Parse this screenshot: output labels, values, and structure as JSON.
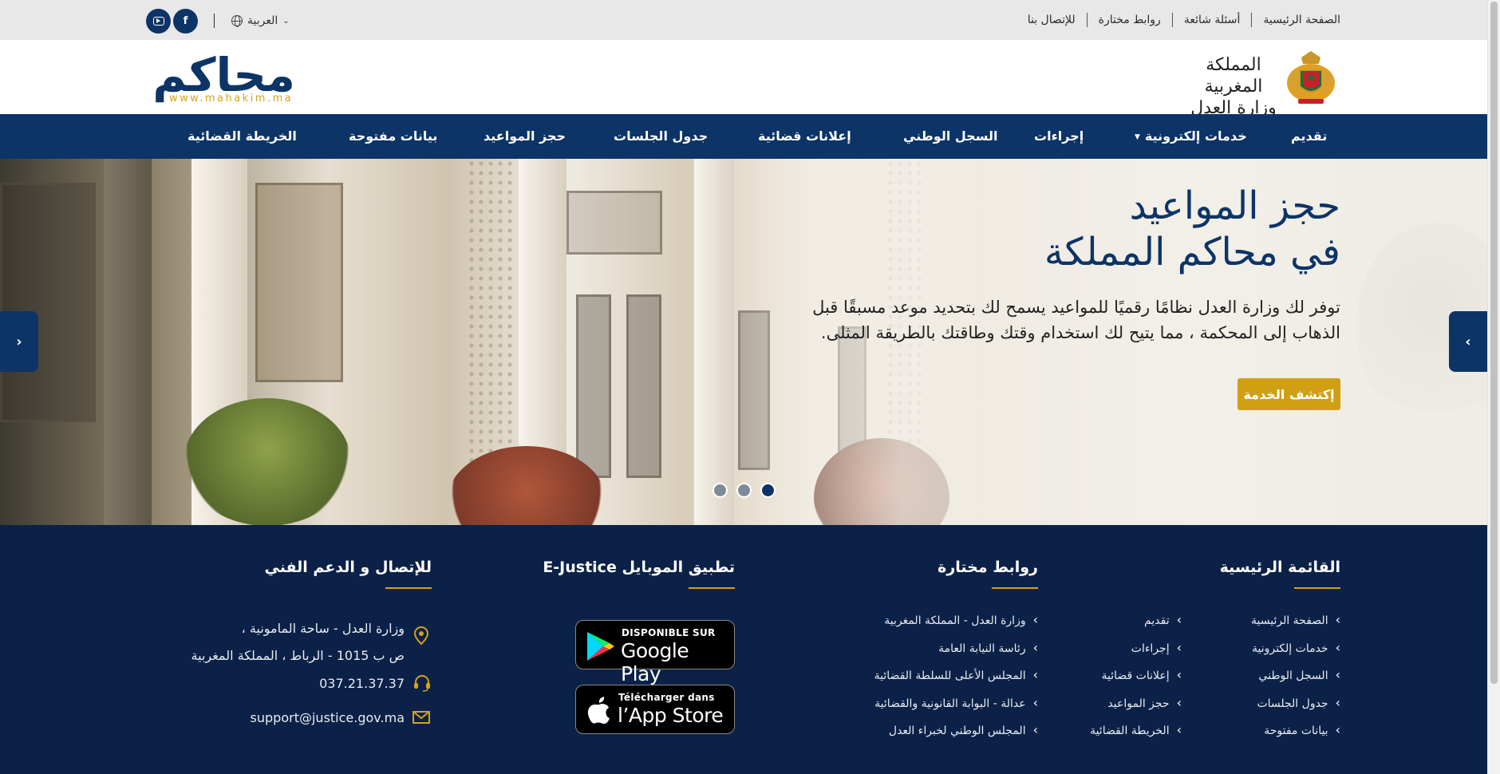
{
  "topbar": {
    "links": [
      "الصفحة الرئيسية",
      "أسئلة شائعة",
      "روابط مختارة",
      "للإتصال بنا"
    ],
    "language": "العربية",
    "social": [
      {
        "name": "facebook-icon",
        "glyph": "f"
      },
      {
        "name": "youtube-icon",
        "glyph": "▶"
      }
    ]
  },
  "header": {
    "logo_text": "محاكم",
    "logo_url": "www.mahakim.ma",
    "ministry_line1": "المملكة المغربية",
    "ministry_line2": "وزارة العدل"
  },
  "nav": {
    "items": [
      "تقديم",
      "خدمات إلكترونية",
      "إجراءات",
      "السجل الوطني",
      "إعلانات قضائية",
      "جدول الجلسات",
      "حجز المواعيد",
      "بيانات مفتوحة",
      "الخريطة القضائية"
    ]
  },
  "hero": {
    "title_line1": "حجز المواعيد",
    "title_line2": "في محاكم المملكة",
    "description": "توفر لك وزارة العدل نظامًا رقميًا للمواعيد يسمح لك بتحديد موعد مسبقًا قبل الذهاب إلى المحكمة ، مما يتيح لك استخدام وقتك وطاقتك بالطريقة المثلى.",
    "button": "إكتشف الخدمة",
    "prev_glyph": "‹",
    "next_glyph": "›",
    "slides_count": 3,
    "active_slide": 1
  },
  "footer": {
    "col_main": {
      "title": "القائمة الرئيسية",
      "list_a": [
        "الصفحة الرئيسية",
        "خدمات إلكترونية",
        "السجل الوطني",
        "جدول الجلسات",
        "بيانات مفتوحة"
      ],
      "list_b": [
        "تقديم",
        "إجراءات",
        "إعلانات قضائية",
        "حجز المواعيد",
        "الخريطة القضائية"
      ]
    },
    "col_links": {
      "title": "روابط مختارة",
      "list": [
        "وزارة العدل - المملكة المغربية",
        "رئاسة النيابة العامة",
        "المجلس الأعلى للسلطة القضائية",
        "عدالة - البوابة القانونية والقضائية",
        "المجلس الوطني لخبراء العدل"
      ]
    },
    "col_app": {
      "title": "تطبيق الموبايل E-Justice",
      "google_small": "DISPONIBLE SUR",
      "google_big": "Google Play",
      "apple_small": "Télécharger dans",
      "apple_big": "l’App Store"
    },
    "col_contact": {
      "title": "للإتصال و الدعم الفني",
      "address_line1": "وزارة العدل - ساحة المامونية ،",
      "address_line2": "ص ب 1015 - الرباط ، المملكة المغربية",
      "phone": "037.21.37.37",
      "email": "support@justice.gov.ma"
    }
  },
  "colors": {
    "primary": "#0d3466",
    "accent": "#d09f13",
    "footer_bg": "#0b2147",
    "topbar_bg": "#e8e8e8"
  }
}
